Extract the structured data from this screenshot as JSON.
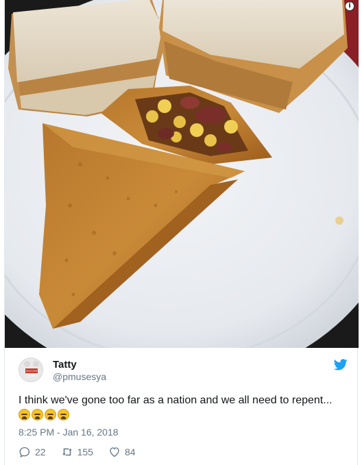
{
  "tweet": {
    "author_name": "Tatty",
    "author_handle": "@pmusesya",
    "avatar_caption": "SOCCER MOM",
    "text": "I think we've gone too far as a nation and we all need to repent...",
    "emoji": "😩😩😩😩",
    "emoji_name": "weary-face",
    "emoji_count": 4,
    "timestamp": "8:25 PM - Jan 16, 2018",
    "replies": "22",
    "retweets": "155",
    "likes": "84"
  },
  "icons": {
    "info": "i",
    "brand": "twitter-bird-icon",
    "reply": "speech-bubble-icon",
    "retweet": "retweet-arrows-icon",
    "like": "heart-icon"
  },
  "colors": {
    "brand": "#1da1f2",
    "secondary_text": "#657786",
    "primary_text": "#14171a"
  }
}
